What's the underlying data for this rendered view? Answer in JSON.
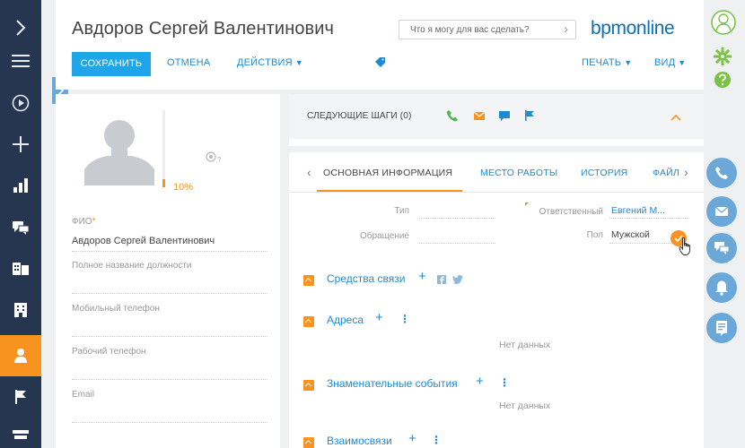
{
  "header": {
    "title": "Авдоров Сергей Валентинович",
    "command_placeholder": "Что я могу для вас сделать?",
    "logo": "bpmonline",
    "save_label": "СОХРАНИТЬ",
    "cancel_label": "ОТМЕНА",
    "actions_label": "ДЕЙСТВИЯ",
    "print_label": "ПЕЧАТЬ",
    "view_label": "ВИД"
  },
  "profile": {
    "completeness": "10%",
    "completeness_value": 10,
    "hint_mark": "?",
    "fields": [
      {
        "label": "ФИО",
        "value": "Авдоров Сергей Валентинович",
        "required": "*"
      },
      {
        "label": "Полное название должности",
        "value": ""
      },
      {
        "label": "Мобильный телефон",
        "value": ""
      },
      {
        "label": "Рабочий телефон",
        "value": ""
      },
      {
        "label": "Email",
        "value": ""
      }
    ]
  },
  "next_steps": {
    "title": "СЛЕДУЮЩИЕ ШАГИ (0)"
  },
  "tabs": {
    "items": [
      "ОСНОВНАЯ ИНФОРМАЦИЯ",
      "МЕСТО РАБОТЫ",
      "ИСТОРИЯ",
      "ФАЙЛ"
    ],
    "active": 0
  },
  "form": {
    "type_label": "Тип",
    "salutation_label": "Обращение",
    "owner_label": "Ответственный",
    "owner_value": "Евгений М...",
    "gender_label": "Пол",
    "gender_value": "Мужской"
  },
  "groups": [
    {
      "title": "Средства связи",
      "empty_text": ""
    },
    {
      "title": "Адреса",
      "empty_text": "Нет данных"
    },
    {
      "title": "Знаменательные события",
      "empty_text": "Нет данных"
    },
    {
      "title": "Взаимосвязи",
      "empty_text": ""
    }
  ],
  "colors": {
    "sidebar": "#263650",
    "accent": "#f7931e",
    "primary": "#1fa6e9",
    "link": "#1e8bd0",
    "right_icons": "#6ba8d8",
    "logo_icon": "#7cc242"
  }
}
